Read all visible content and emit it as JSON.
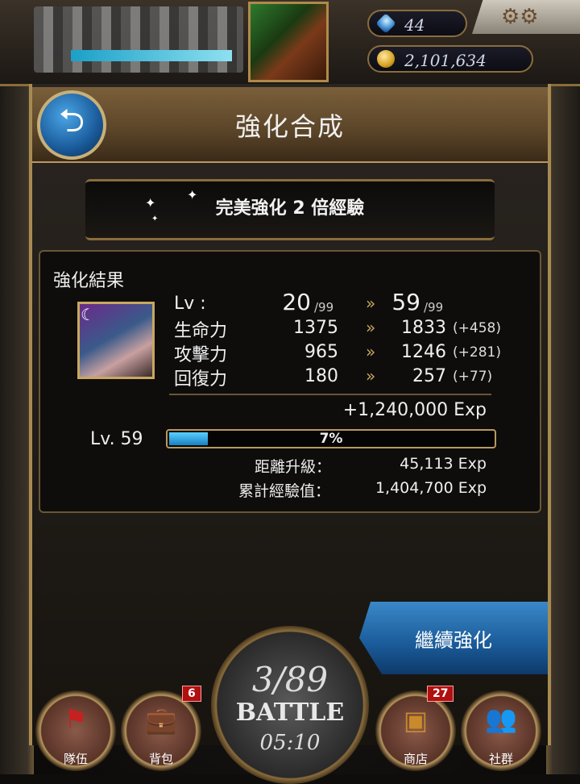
{
  "header": {
    "gems": "44",
    "coins": "2,101,634"
  },
  "title": "強化合成",
  "banner": "完美強化 2 倍經驗",
  "results": {
    "title": "強化結果",
    "lv_label": "Lv :",
    "lv_before": "20",
    "lv_after": "59",
    "lv_max": "/99",
    "stats": [
      {
        "label": "生命力",
        "before": "1375",
        "after": "1833",
        "bonus": "(+458)"
      },
      {
        "label": "攻擊力",
        "before": "965",
        "after": "1246",
        "bonus": "(+281)"
      },
      {
        "label": "回復力",
        "before": "180",
        "after": "257",
        "bonus": "(+77)"
      }
    ],
    "exp_gain": "+1,240,000 Exp",
    "level_text": "Lv. 59",
    "progress_percent": 7,
    "progress_label": "7%",
    "next_label": "距離升級：",
    "next_value": "45,113 Exp",
    "total_label": "累計經驗值：",
    "total_value": "1,404,700 Exp"
  },
  "continue_label": "繼續強化",
  "battle": {
    "count": "3/89",
    "label": "BATTLE",
    "time": "05:10"
  },
  "nav": {
    "team": "隊伍",
    "bag": "背包",
    "bag_badge": "6",
    "shop": "商店",
    "shop_badge": "27",
    "social": "社群"
  },
  "colors": {
    "gold": "#b89860",
    "blue": "#1a5a98",
    "badge": "#b01010"
  }
}
